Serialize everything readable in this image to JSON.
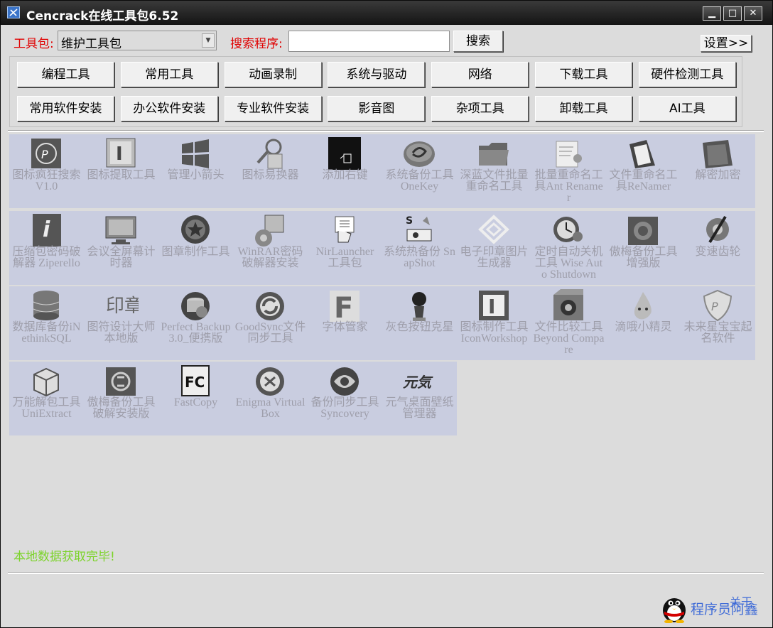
{
  "window": {
    "title": "Cencrack在线工具包6.52"
  },
  "toolbar": {
    "package_label": "工具包:",
    "package_value": "维护工具包",
    "search_label": "搜索程序:",
    "search_value": "",
    "search_button": "搜索",
    "settings_button": "设置>>"
  },
  "categories": [
    "编程工具",
    "常用工具",
    "动画录制",
    "系统与驱动",
    "网络",
    "下载工具",
    "硬件检测工具",
    "常用软件安装",
    "办公软件安装",
    "专业软件安装",
    "影音图",
    "杂项工具",
    "卸载工具",
    "AI工具"
  ],
  "tools": [
    {
      "label": "图标疯狂搜索 V1.0",
      "icon": "icon-crazy-icon"
    },
    {
      "label": "图标提取工具",
      "icon": "icon-extract-icon"
    },
    {
      "label": "管理小箭头",
      "icon": "windows-logo-icon"
    },
    {
      "label": "图标易换器",
      "icon": "icon-changer-icon"
    },
    {
      "label": "添加右键",
      "icon": "context-menu-icon"
    },
    {
      "label": "系统备份工具OneKey",
      "icon": "onekey-icon"
    },
    {
      "label": "深蓝文件批量重命名工具",
      "icon": "folder-icon"
    },
    {
      "label": "批量重命名工具Ant Renamer",
      "icon": "ant-renamer-icon"
    },
    {
      "label": "文件重命名工具ReNamer",
      "icon": "renamer-icon"
    },
    {
      "label": "解密加密",
      "icon": "folder-encrypt-icon"
    },
    {
      "label": "压缩包密码破解器 Ziperello",
      "icon": "ziperello-icon"
    },
    {
      "label": "会议全屏幕计时器",
      "icon": "monitor-icon"
    },
    {
      "label": "图章制作工具",
      "icon": "stamp-icon"
    },
    {
      "label": "WinRAR密码破解器安装",
      "icon": "winrar-crack-icon"
    },
    {
      "label": "NirLauncher 工具包",
      "icon": "nirlauncher-icon"
    },
    {
      "label": "系统热备份 SnapShot",
      "icon": "snapshot-icon"
    },
    {
      "label": "电子印章图片生成器",
      "icon": "seal-generator-icon"
    },
    {
      "label": "定时自动关机工具 Wise Auto Shutdown",
      "icon": "clock-icon"
    },
    {
      "label": "傲梅备份工具增强版",
      "icon": "aomei-icon"
    },
    {
      "label": "变速齿轮",
      "icon": "gear-speed-icon"
    },
    {
      "label": "数据库备份iNethinkSQL",
      "icon": "database-icon"
    },
    {
      "label": "图符设计大师本地版",
      "icon": "seal-text-icon"
    },
    {
      "label": "Perfect Backup 3.0_便携版",
      "icon": "perfect-backup-icon"
    },
    {
      "label": "GoodSync文件同步工具",
      "icon": "goodsync-icon"
    },
    {
      "label": "字体管家",
      "icon": "font-icon"
    },
    {
      "label": "灰色按钮克星",
      "icon": "sonic-icon"
    },
    {
      "label": "图标制作工具IconWorkshop",
      "icon": "iconworkshop-icon"
    },
    {
      "label": "文件比较工具Beyond Compare",
      "icon": "beyond-compare-icon"
    },
    {
      "label": "滴哦小精灵",
      "icon": "drop-sprite-icon"
    },
    {
      "label": "未来星宝宝起名软件",
      "icon": "shield-icon"
    },
    {
      "label": "万能解包工具 UniExtract",
      "icon": "box-icon"
    },
    {
      "label": "傲梅备份工具破解安装版",
      "icon": "aomei-crack-icon"
    },
    {
      "label": "FastCopy",
      "icon": "fastcopy-icon"
    },
    {
      "label": "Enigma Virtual Box",
      "icon": "enigma-icon"
    },
    {
      "label": "备份同步工具Syncovery",
      "icon": "syncovery-icon"
    },
    {
      "label": "元气桌面壁纸管理器",
      "icon": "yuanqi-icon"
    }
  ],
  "status": "本地数据获取完毕!",
  "footer": {
    "author": "程序员阿鑫",
    "about": "关于"
  }
}
